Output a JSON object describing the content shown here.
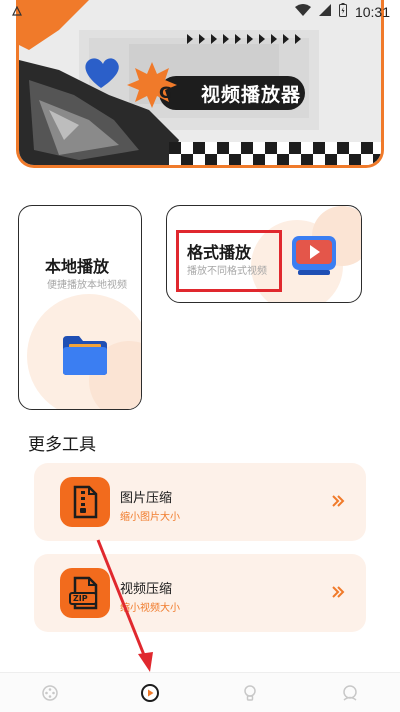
{
  "status_bar": {
    "time": "10:31",
    "icons": [
      "app-notification-icon",
      "wifi-icon",
      "signal-icon",
      "battery-icon"
    ]
  },
  "banner": {
    "badge_letter": "G",
    "title": "视频播放器",
    "accent_color": "#f07a2a",
    "heart_color": "#2b5fc9"
  },
  "cards": {
    "local": {
      "title": "本地播放",
      "subtitle": "便捷播放本地视频",
      "icon": "folder-icon"
    },
    "format": {
      "title": "格式播放",
      "subtitle": "播放不同格式视频",
      "icon": "video-player-icon"
    }
  },
  "more_tools": {
    "section_title": "更多工具",
    "items": [
      {
        "title": "图片压缩",
        "subtitle": "缩小图片大小",
        "icon": "zip-file-icon"
      },
      {
        "title": "视频压缩",
        "subtitle": "缩小视频大小",
        "icon": "zip-archive-icon",
        "icon_label": "ZIP"
      }
    ]
  },
  "bottom_nav": {
    "items": [
      {
        "icon": "film-reel-icon",
        "active": false
      },
      {
        "icon": "play-icon",
        "active": true
      },
      {
        "icon": "lightbulb-icon",
        "active": false
      },
      {
        "icon": "profile-icon",
        "active": false
      }
    ]
  },
  "colors": {
    "accent": "#f07a2a",
    "annotation_red": "#e0282e",
    "tool_bg": "#fdf1e9"
  }
}
